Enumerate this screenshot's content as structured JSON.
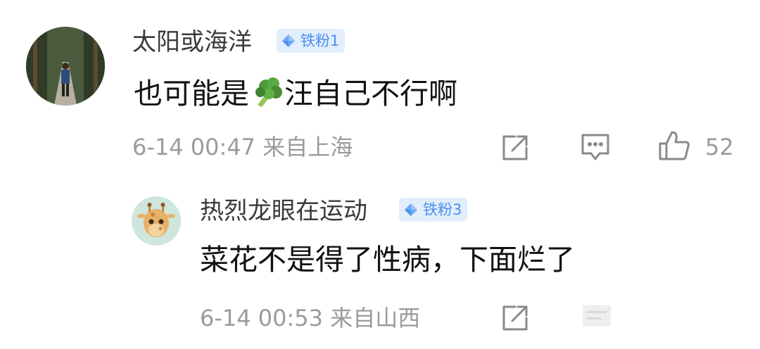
{
  "comment": {
    "username": "太阳或海洋",
    "badge": "铁粉1",
    "text_before": "也可能是",
    "emoji": "broccoli-emoji",
    "text_after": "汪自己不行啊",
    "time": "6-14 00:47",
    "location": "来自上海",
    "likes": "52"
  },
  "reply": {
    "username": "热烈龙眼在运动",
    "badge": "铁粉3",
    "text": "菜花不是得了性病，下面烂了",
    "time": "6-14 00:53",
    "location": "来自山西"
  },
  "colors": {
    "badge_bg": "#e3eefc",
    "badge_text": "#4c8ff0",
    "meta": "#9b9b9b"
  }
}
